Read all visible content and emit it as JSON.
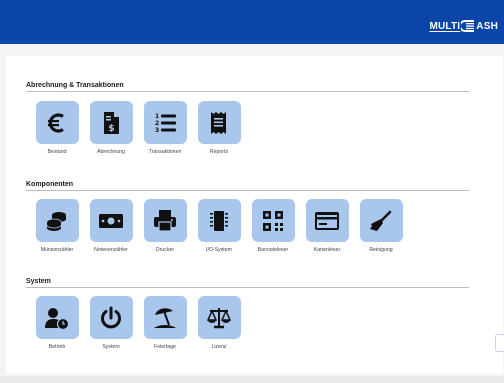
{
  "brand": {
    "logo_prefix": "MULTI",
    "logo_suffix": "ASH"
  },
  "sections": [
    {
      "title": "Abrechnung & Transaktionen",
      "items": [
        {
          "label": "Bestand",
          "icon": "euro-icon"
        },
        {
          "label": "Abrechnung",
          "icon": "invoice-icon"
        },
        {
          "label": "Transaktionen",
          "icon": "numbered-list-icon"
        },
        {
          "label": "Reports",
          "icon": "receipt-icon"
        }
      ]
    },
    {
      "title": "Komponenten",
      "items": [
        {
          "label": "Münzenzähler",
          "icon": "coins-icon"
        },
        {
          "label": "Notenenzähler",
          "icon": "banknote-icon"
        },
        {
          "label": "Drucker",
          "icon": "printer-icon"
        },
        {
          "label": "I/O-System",
          "icon": "chip-icon"
        },
        {
          "label": "Barcodeleser",
          "icon": "qr-code-icon"
        },
        {
          "label": "Kartenleser",
          "icon": "credit-card-icon"
        },
        {
          "label": "Reinigung",
          "icon": "broom-icon"
        }
      ]
    },
    {
      "title": "System",
      "items": [
        {
          "label": "Betrieb",
          "icon": "user-clock-icon"
        },
        {
          "label": "System",
          "icon": "power-icon"
        },
        {
          "label": "Feiertage",
          "icon": "umbrella-beach-icon"
        },
        {
          "label": "Lizenz",
          "icon": "scales-icon"
        }
      ]
    }
  ],
  "colors": {
    "header": "#0b45a8",
    "tile": "#a9c7ec",
    "icon": "#111111"
  }
}
